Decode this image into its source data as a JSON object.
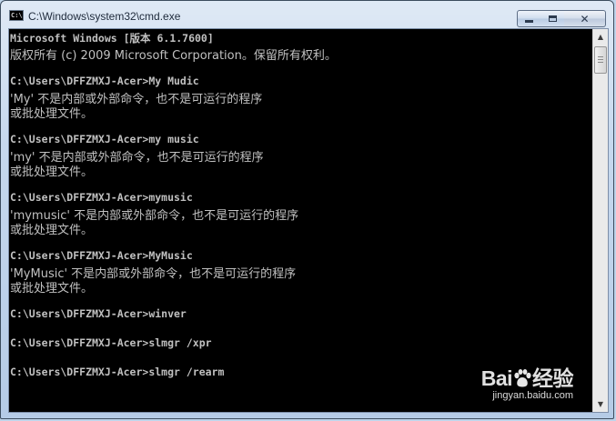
{
  "window": {
    "title": "C:\\Windows\\system32\\cmd.exe",
    "icon": "cmd-icon",
    "controls": {
      "minimize": "minimize-icon",
      "maximize": "maximize-icon",
      "close": "close-icon"
    }
  },
  "console": {
    "lines": [
      {
        "text": "Microsoft Windows [版本 6.1.7600]",
        "kind": "mono"
      },
      {
        "text": "版权所有 (c) 2009 Microsoft Corporation。保留所有权利。",
        "kind": "zh"
      },
      {
        "text": "",
        "kind": "mono"
      },
      {
        "text": "C:\\Users\\DFFZMXJ-Acer>My Mudic",
        "kind": "mono"
      },
      {
        "text": "'My' 不是内部或外部命令，也不是可运行的程序",
        "kind": "zh"
      },
      {
        "text": "或批处理文件。",
        "kind": "zh"
      },
      {
        "text": "",
        "kind": "mono"
      },
      {
        "text": "C:\\Users\\DFFZMXJ-Acer>my music",
        "kind": "mono"
      },
      {
        "text": "'my' 不是内部或外部命令，也不是可运行的程序",
        "kind": "zh"
      },
      {
        "text": "或批处理文件。",
        "kind": "zh"
      },
      {
        "text": "",
        "kind": "mono"
      },
      {
        "text": "C:\\Users\\DFFZMXJ-Acer>mymusic",
        "kind": "mono"
      },
      {
        "text": "'mymusic' 不是内部或外部命令，也不是可运行的程序",
        "kind": "zh"
      },
      {
        "text": "或批处理文件。",
        "kind": "zh"
      },
      {
        "text": "",
        "kind": "mono"
      },
      {
        "text": "C:\\Users\\DFFZMXJ-Acer>MyMusic",
        "kind": "mono"
      },
      {
        "text": "'MyMusic' 不是内部或外部命令，也不是可运行的程序",
        "kind": "zh"
      },
      {
        "text": "或批处理文件。",
        "kind": "zh"
      },
      {
        "text": "",
        "kind": "mono"
      },
      {
        "text": "C:\\Users\\DFFZMXJ-Acer>winver",
        "kind": "mono"
      },
      {
        "text": "",
        "kind": "mono"
      },
      {
        "text": "C:\\Users\\DFFZMXJ-Acer>slmgr /xpr",
        "kind": "mono"
      },
      {
        "text": "",
        "kind": "mono"
      },
      {
        "text": "C:\\Users\\DFFZMXJ-Acer>slmgr /rearm",
        "kind": "mono"
      }
    ]
  },
  "scrollbar": {
    "up_icon": "scroll-up-arrow-icon",
    "down_icon": "scroll-down-arrow-icon"
  },
  "watermark": {
    "logo_left": "Bai",
    "logo_right": "经验",
    "logo_icon": "baidu-paw-icon",
    "url": "jingyan.baidu.com"
  },
  "colors": {
    "console_bg": "#000000",
    "console_fg": "#c0c0c0",
    "titlebar": "#c6d8ee"
  }
}
